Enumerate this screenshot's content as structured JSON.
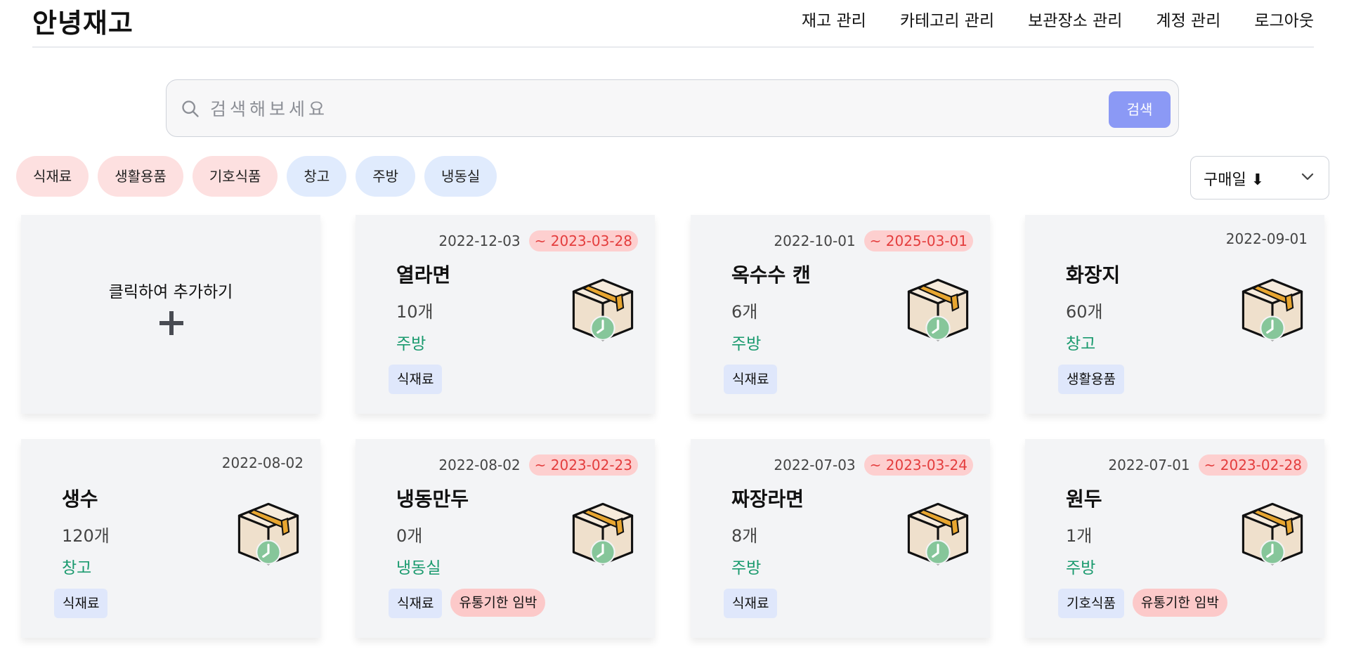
{
  "header": {
    "logo": "안녕재고",
    "nav": [
      "재고 관리",
      "카테고리 관리",
      "보관장소 관리",
      "계정 관리",
      "로그아웃"
    ]
  },
  "search": {
    "placeholder": "검색해보세요",
    "button_label": "검색"
  },
  "filters": {
    "categories": [
      "식재료",
      "생활용품",
      "기호식품"
    ],
    "locations": [
      "창고",
      "주방",
      "냉동실"
    ]
  },
  "sort": {
    "label": "구매일 ⬇"
  },
  "add_card": {
    "label": "클릭하여 추가하기"
  },
  "items": [
    {
      "name": "열라면",
      "quantity": "10개",
      "location": "주방",
      "category": "식재료",
      "purchase_date": "2022-12-03",
      "expiry": "~ 2023-03-28",
      "warning": ""
    },
    {
      "name": "옥수수 캔",
      "quantity": "6개",
      "location": "주방",
      "category": "식재료",
      "purchase_date": "2022-10-01",
      "expiry": "~ 2025-03-01",
      "warning": ""
    },
    {
      "name": "화장지",
      "quantity": "60개",
      "location": "창고",
      "category": "생활용품",
      "purchase_date": "2022-09-01",
      "expiry": "",
      "warning": ""
    },
    {
      "name": "생수",
      "quantity": "120개",
      "location": "창고",
      "category": "식재료",
      "purchase_date": "2022-08-02",
      "expiry": "",
      "warning": ""
    },
    {
      "name": "냉동만두",
      "quantity": "0개",
      "location": "냉동실",
      "category": "식재료",
      "purchase_date": "2022-08-02",
      "expiry": "~ 2023-02-23",
      "warning": "유통기한 임박"
    },
    {
      "name": "짜장라면",
      "quantity": "8개",
      "location": "주방",
      "category": "식재료",
      "purchase_date": "2022-07-03",
      "expiry": "~ 2023-03-24",
      "warning": ""
    },
    {
      "name": "원두",
      "quantity": "1개",
      "location": "주방",
      "category": "기호식품",
      "purchase_date": "2022-07-01",
      "expiry": "~ 2023-02-28",
      "warning": "유통기한 임박"
    }
  ],
  "icons": {
    "search": "search-icon",
    "sort": "chevron-down-icon",
    "add": "plus-icon",
    "item": "box-clock-icon"
  },
  "colors": {
    "accent": "#8b99f5",
    "location_text": "#1a9a6e",
    "expiry_text": "#e43d3d",
    "expiry_bg": "#fdcfcf",
    "category_chip": "#fde0e0",
    "location_chip": "#e0ebfd",
    "tag_bg": "#dfe7fb",
    "warning_bg": "#fcc9c9"
  }
}
